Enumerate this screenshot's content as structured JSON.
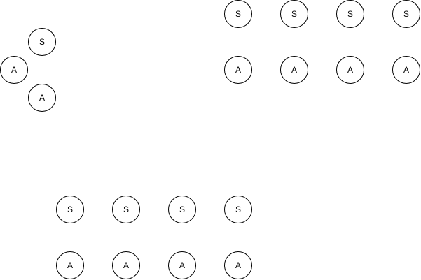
{
  "diagram": {
    "colors": {
      "background": "#ffffff",
      "stroke": "#000000",
      "fill": "#ffffff",
      "text": "#000000"
    },
    "clusters": [
      {
        "id": "triangle-cluster",
        "nodes": [
          {
            "label": "S"
          },
          {
            "label": "A"
          },
          {
            "label": "A"
          }
        ]
      },
      {
        "id": "top-right-grid",
        "nodes": [
          {
            "label": "S"
          },
          {
            "label": "S"
          },
          {
            "label": "S"
          },
          {
            "label": "S"
          },
          {
            "label": "A"
          },
          {
            "label": "A"
          },
          {
            "label": "A"
          },
          {
            "label": "A"
          }
        ]
      },
      {
        "id": "bottom-grid",
        "nodes": [
          {
            "label": "S"
          },
          {
            "label": "S"
          },
          {
            "label": "S"
          },
          {
            "label": "S"
          },
          {
            "label": "A"
          },
          {
            "label": "A"
          },
          {
            "label": "A"
          },
          {
            "label": "A"
          }
        ]
      }
    ]
  }
}
